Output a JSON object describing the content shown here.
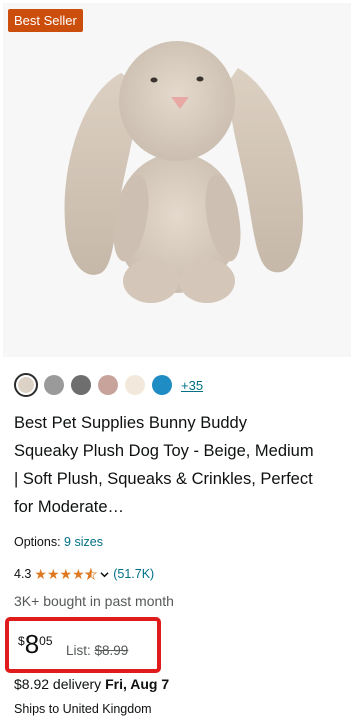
{
  "badge": {
    "label": "Best Seller"
  },
  "product_image": {
    "alt": "bunny plush toy"
  },
  "swatches": {
    "colors": [
      "#ddd2c6",
      "#9a9a9a",
      "#6e6e6e",
      "#c8a39b",
      "#f2e9dc",
      "#1f8cc4"
    ],
    "more_label": "+35"
  },
  "title": "Best Pet Supplies Bunny Buddy Squeaky Plush Dog Toy - Beige, Medium | Soft Plush, Squeaks & Crinkles, Perfect for Moderate…",
  "options": {
    "label": "Options:",
    "value": "9 sizes"
  },
  "rating": {
    "value": "4.3",
    "stars": 4.3,
    "reviews": "(51.7K)"
  },
  "bought": "3K+ bought in past month",
  "price": {
    "currency": "$",
    "whole": "8",
    "fraction": "05",
    "list_label": "List:",
    "list_price": "$8.99"
  },
  "delivery": {
    "text": "$8.92 delivery",
    "date": "Fri, Aug 7"
  },
  "shipping": "Ships to United Kingdom"
}
